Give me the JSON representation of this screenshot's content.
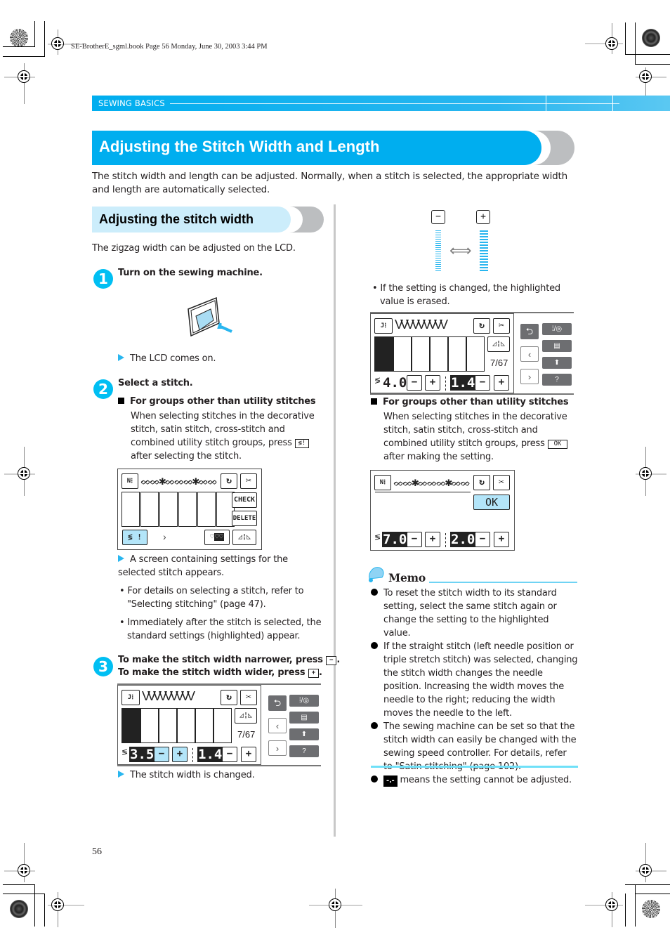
{
  "print_header": "SE-BrotherE_sgml.book  Page 56  Monday, June 30, 2003  3:44 PM",
  "section_band": "SEWING BASICS",
  "title": "Adjusting the Stitch Width and Length",
  "intro": "The stitch width and length can be adjusted. Normally, when a stitch is selected, the appropriate width and length are automatically selected.",
  "subheading": "Adjusting the stitch width",
  "sub_intro": "The zigzag width can be adjusted on the LCD.",
  "colors": {
    "accent": "#00aeef",
    "light_accent": "#ccedfb",
    "highlight": "#b3e5f9",
    "grey": "#bcbec0"
  },
  "steps": [
    {
      "number": "1",
      "title": "Turn on the sewing machine.",
      "result": "The LCD comes on."
    },
    {
      "number": "2",
      "title": "Select a stitch.",
      "subhead": "For groups other than utility stitches",
      "body_before": "When selecting stitches in the decorative stitch, satin stitch, cross-stitch and combined utility stitch groups, press",
      "body_after": "after selecting the stitch.",
      "result": "A screen containing settings for the selected stitch appears.",
      "bullets": [
        "For details on selecting a stitch, refer to \"Selecting stitching\" (page 47).",
        "Immediately after the stitch is selected, the standard settings (highlighted) appear."
      ]
    },
    {
      "number": "3",
      "title_line1": "To make the stitch width narrower, press",
      "title_line2": "To make the stitch width wider, press",
      "result": "The stitch width is changed."
    }
  ],
  "keys": {
    "minus": "−",
    "plus": "+",
    "ok": "OK",
    "check": "CHECK",
    "delete": "DELETE",
    "page_count": "7/67"
  },
  "lcd_step3": {
    "width": "3.5",
    "length": "1.4"
  },
  "lcd_right": {
    "width": "4.0",
    "length": "1.4"
  },
  "lcd_ok": {
    "width": "7.0",
    "length": "2.0"
  },
  "right_col": {
    "changed_note": "If the setting is changed, the highlighted value is erased.",
    "subhead": "For groups other than utility stitches",
    "body_before": "When selecting stitches in the decorative stitch, satin stitch, cross-stitch and combined utility stitch groups, press",
    "body_after": "after making the setting."
  },
  "memo": {
    "title": "Memo",
    "items": [
      "To reset the stitch width to its standard setting, select the same stitch again or change the setting to the highlighted value.",
      "If the straight stitch (left needle position or triple stretch stitch) was selected, changing the stitch width changes the needle position. Increasing the width moves the needle to the right; reducing the width moves the needle to the left.",
      "The sewing machine can be set so that the stitch width can easily be changed with the sewing speed controller. For details, refer to \"Satin stitching\" (page 102).",
      "means the setting cannot be adjusted."
    ],
    "disabled_symbol": "-.-"
  },
  "page_number": "56"
}
